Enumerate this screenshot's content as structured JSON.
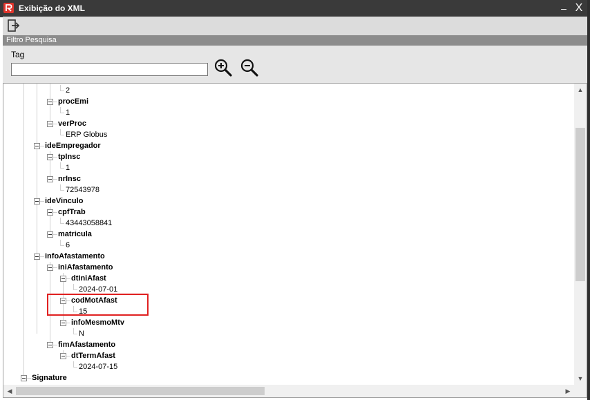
{
  "window": {
    "title": "Exibição do XML",
    "minimize_glyph": "–",
    "close_glyph": "X",
    "app_icon": "globus-logo-icon",
    "accent_color": "#e0362d"
  },
  "toolbar": {
    "exit_icon": "exit-icon"
  },
  "filter": {
    "header": "Filtro Pesquisa",
    "tag_label": "Tag",
    "tag_value": "",
    "zoom_in_icon": "zoom-in-icon",
    "zoom_out_icon": "zoom-out-icon"
  },
  "tree": {
    "rows": [
      {
        "text": "2",
        "kind": "value",
        "level": 3
      },
      {
        "text": "procEmi",
        "kind": "element",
        "level": 2
      },
      {
        "text": "1",
        "kind": "value",
        "level": 3
      },
      {
        "text": "verProc",
        "kind": "element",
        "level": 2
      },
      {
        "text": "ERP Globus",
        "kind": "value",
        "level": 3
      },
      {
        "text": "ideEmpregador",
        "kind": "element",
        "level": 1
      },
      {
        "text": "tpInsc",
        "kind": "element",
        "level": 2
      },
      {
        "text": "1",
        "kind": "value",
        "level": 3
      },
      {
        "text": "nrInsc",
        "kind": "element",
        "level": 2
      },
      {
        "text": "72543978",
        "kind": "value",
        "level": 3
      },
      {
        "text": "ideVinculo",
        "kind": "element",
        "level": 1
      },
      {
        "text": "cpfTrab",
        "kind": "element",
        "level": 2
      },
      {
        "text": "43443058841",
        "kind": "value",
        "level": 3
      },
      {
        "text": "matricula",
        "kind": "element",
        "level": 2
      },
      {
        "text": "6",
        "kind": "value",
        "level": 3
      },
      {
        "text": "infoAfastamento",
        "kind": "element",
        "level": 1
      },
      {
        "text": "iniAfastamento",
        "kind": "element",
        "level": 2
      },
      {
        "text": "dtIniAfast",
        "kind": "element",
        "level": 3
      },
      {
        "text": "2024-07-01",
        "kind": "value",
        "level": 4
      },
      {
        "text": "codMotAfast",
        "kind": "element",
        "level": 3
      },
      {
        "text": "15",
        "kind": "value",
        "level": 4
      },
      {
        "text": "infoMesmoMtv",
        "kind": "element",
        "level": 3
      },
      {
        "text": "N",
        "kind": "value",
        "level": 4
      },
      {
        "text": "fimAfastamento",
        "kind": "element",
        "level": 2
      },
      {
        "text": "dtTermAfast",
        "kind": "element",
        "level": 3
      },
      {
        "text": "2024-07-15",
        "kind": "value",
        "level": 4
      },
      {
        "text": "Signature",
        "kind": "element",
        "level": 0
      }
    ],
    "highlighted": "codMotAfast",
    "highlight_color": "#e02020"
  },
  "scrollbars": {
    "up_glyph": "▲",
    "down_glyph": "▼",
    "left_glyph": "◀",
    "right_glyph": "▶"
  }
}
